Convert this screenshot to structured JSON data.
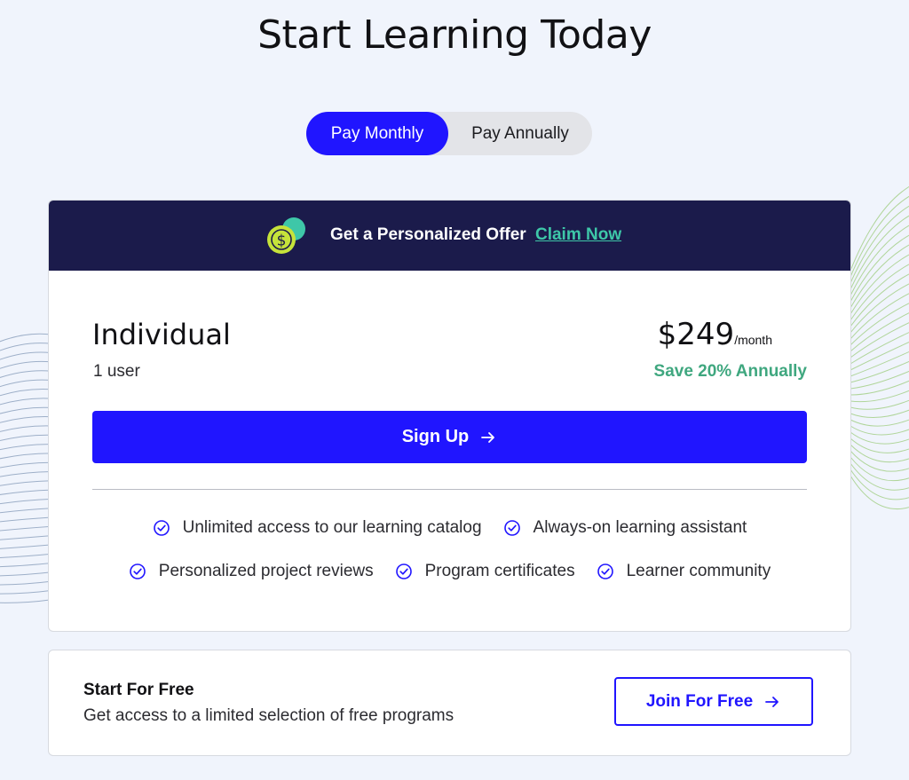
{
  "page": {
    "title": "Start Learning Today"
  },
  "billing_toggle": {
    "options": [
      "Pay Monthly",
      "Pay Annually"
    ],
    "selected": "Pay Monthly"
  },
  "offer_banner": {
    "text": "Get a Personalized Offer",
    "link": "Claim Now",
    "icon": "coin-icon"
  },
  "plan": {
    "name": "Individual",
    "users": "1 user",
    "price": "$249",
    "period": "/month",
    "savings": "Save 20% Annually",
    "cta": "Sign Up",
    "features": [
      "Unlimited access to our learning catalog",
      "Always-on learning assistant",
      "Personalized project reviews",
      "Program certificates",
      "Learner community"
    ]
  },
  "free_plan": {
    "title": "Start For Free",
    "description": "Get access to a limited selection of free programs",
    "cta": "Join For Free"
  },
  "colors": {
    "accent": "#2015ff",
    "banner": "#1b1b4b",
    "link": "#3ec7a8",
    "savings": "#3fa77f",
    "background": "#f0f4fc"
  }
}
